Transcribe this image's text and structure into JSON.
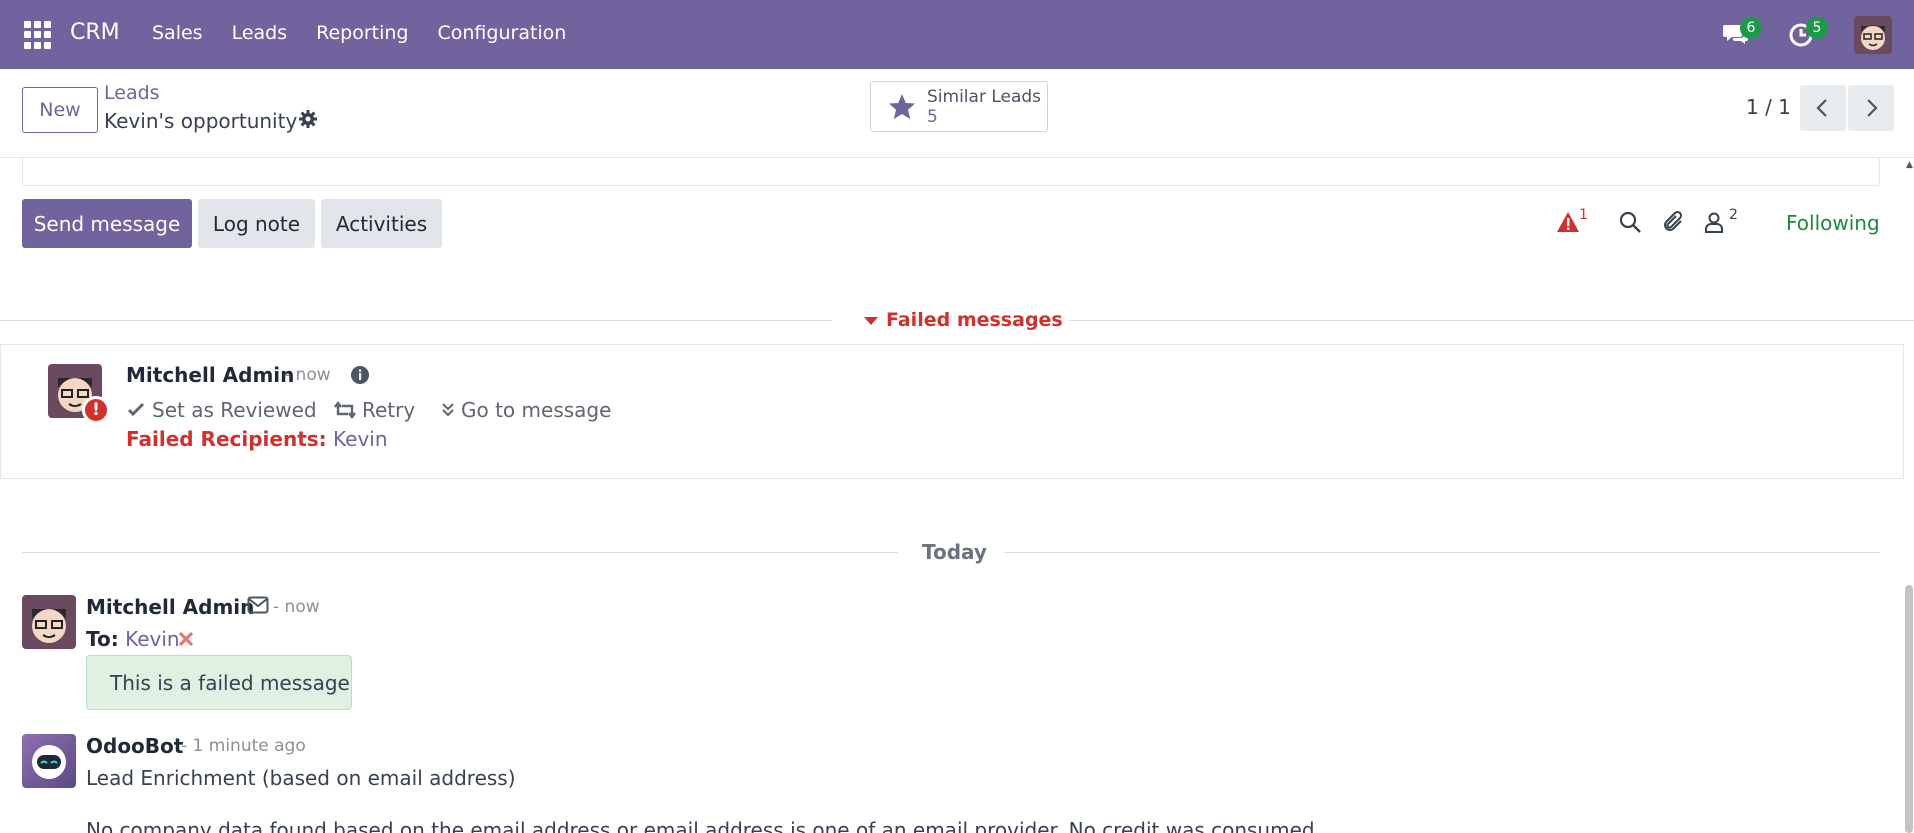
{
  "navbar": {
    "brand": "CRM",
    "menu": [
      "Sales",
      "Leads",
      "Reporting",
      "Configuration"
    ],
    "messages_count": "6",
    "activities_count": "5",
    "bg_color": "#71639e"
  },
  "control_panel": {
    "new_label": "New",
    "breadcrumb_parent": "Leads",
    "breadcrumb_current": "Kevin's opportunity",
    "similar_label": "Similar Leads",
    "similar_count": "5",
    "pager": "1 / 1"
  },
  "chatter": {
    "send_message": "Send message",
    "log_note": "Log note",
    "activities": "Activities",
    "failure_count": "1",
    "followers_count": "2",
    "following": "Following"
  },
  "failed_section": {
    "title": "Failed messages",
    "author": "Mitchell Admin",
    "time": "- now",
    "set_reviewed": "Set as Reviewed",
    "retry": "Retry",
    "goto": "Go to message",
    "failed_recipients_label": "Failed Recipients:",
    "failed_recipients_value": "Kevin"
  },
  "thread": {
    "date_separator": "Today",
    "messages": [
      {
        "author": "Mitchell Admin",
        "time": "- now",
        "to_label": "To:",
        "to_value": "Kevin",
        "body": "This is a failed message"
      },
      {
        "author": "OdooBot",
        "time": "- 1 minute ago",
        "line1": "Lead Enrichment (based on email address)",
        "line2": "No company data found based on the email address or email address is one of an email provider. No credit was consumed."
      }
    ]
  },
  "colors": {
    "accent": "#71639e",
    "danger": "#d0312d",
    "success": "#1b8a3c"
  }
}
